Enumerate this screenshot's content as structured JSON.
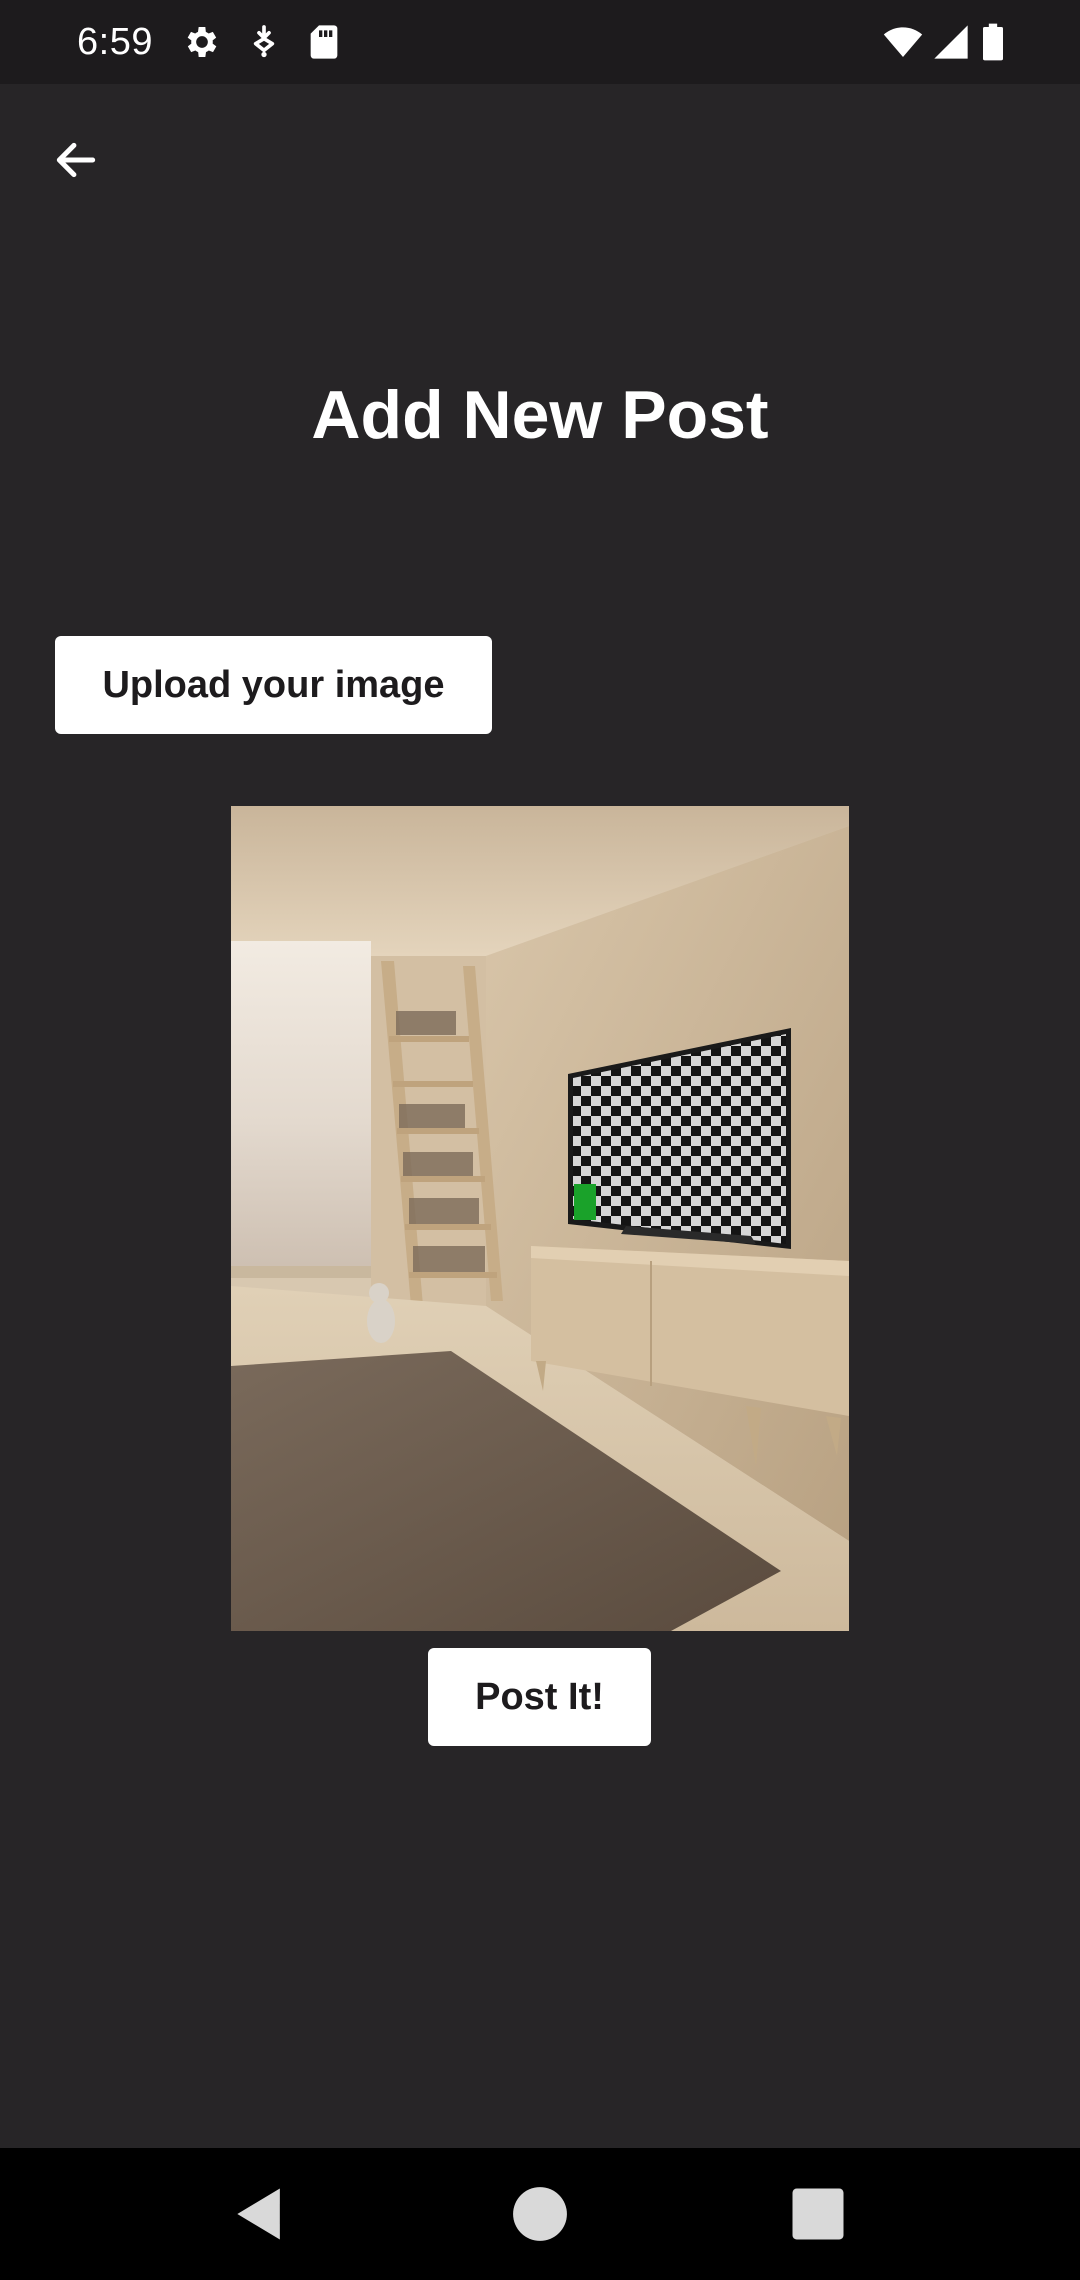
{
  "status_bar": {
    "time": "6:59",
    "left_icons": [
      "gear-icon",
      "download-icon",
      "sd-card-icon"
    ],
    "right_icons": [
      "wifi-icon",
      "signal-icon",
      "battery-icon"
    ]
  },
  "app_bar": {
    "back_icon": "arrow-left-icon"
  },
  "page": {
    "title": "Add New Post",
    "upload_label": "Upload your image",
    "post_label": "Post It!",
    "preview_alt": "Selected image preview: living room with TV showing checkerboard"
  },
  "nav_bar": {
    "icons": [
      "back-triangle-icon",
      "home-circle-icon",
      "recents-square-icon"
    ]
  },
  "colors": {
    "background": "#272527",
    "status_bar": "#1d1b1d",
    "button_bg": "#ffffff",
    "button_text": "#1d1b1d",
    "title_text": "#ffffff"
  }
}
